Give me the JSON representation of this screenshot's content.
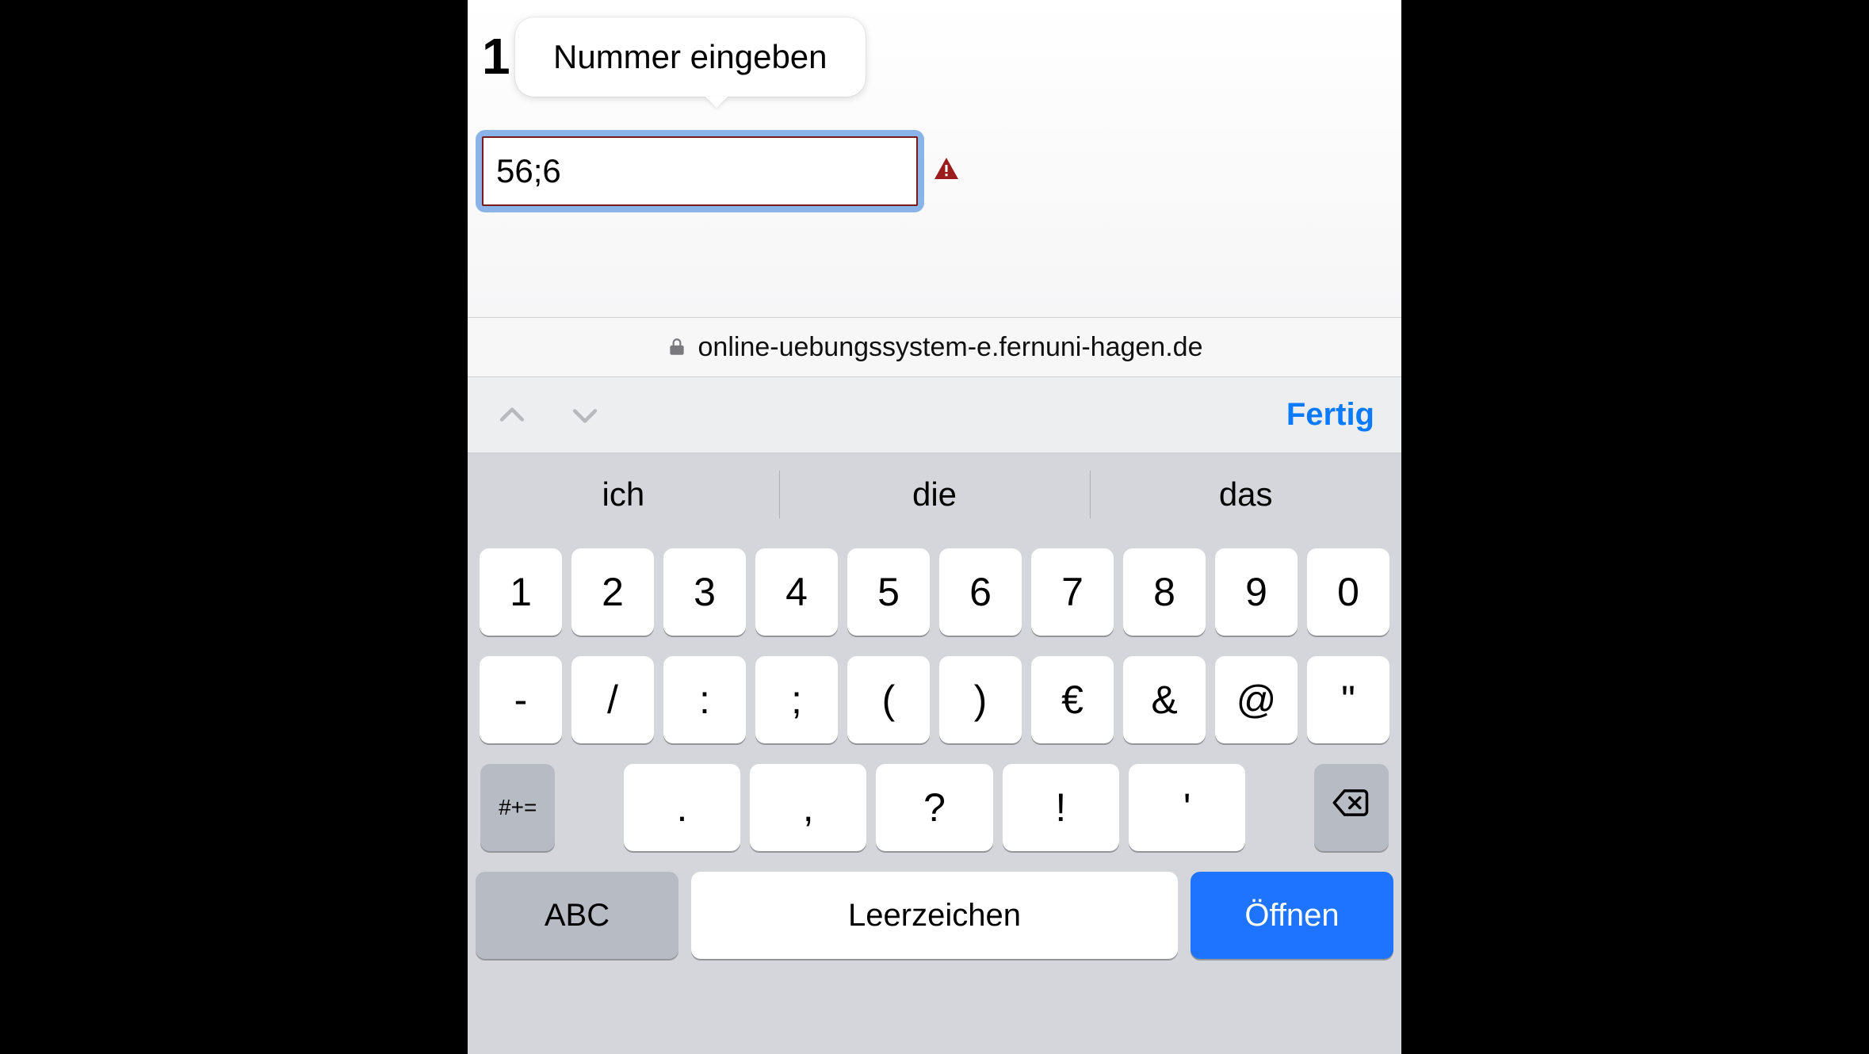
{
  "content": {
    "question_number": "1",
    "tooltip": "Nummer eingeben",
    "input_value": "56;6"
  },
  "addressbar": {
    "domain": "online-uebungssystem-e.fernuni-hagen.de"
  },
  "accessory": {
    "done": "Fertig"
  },
  "suggestions": [
    "ich",
    "die",
    "das"
  ],
  "keyboard": {
    "row1": [
      "1",
      "2",
      "3",
      "4",
      "5",
      "6",
      "7",
      "8",
      "9",
      "0"
    ],
    "row2": [
      "-",
      "/",
      ":",
      ";",
      "(",
      ")",
      "€",
      "&",
      "@",
      "\""
    ],
    "mode_key": "#+=",
    "row3": [
      ".",
      ",",
      "?",
      "!",
      "'"
    ],
    "abc": "ABC",
    "space": "Leerzeichen",
    "open": "Öffnen"
  }
}
